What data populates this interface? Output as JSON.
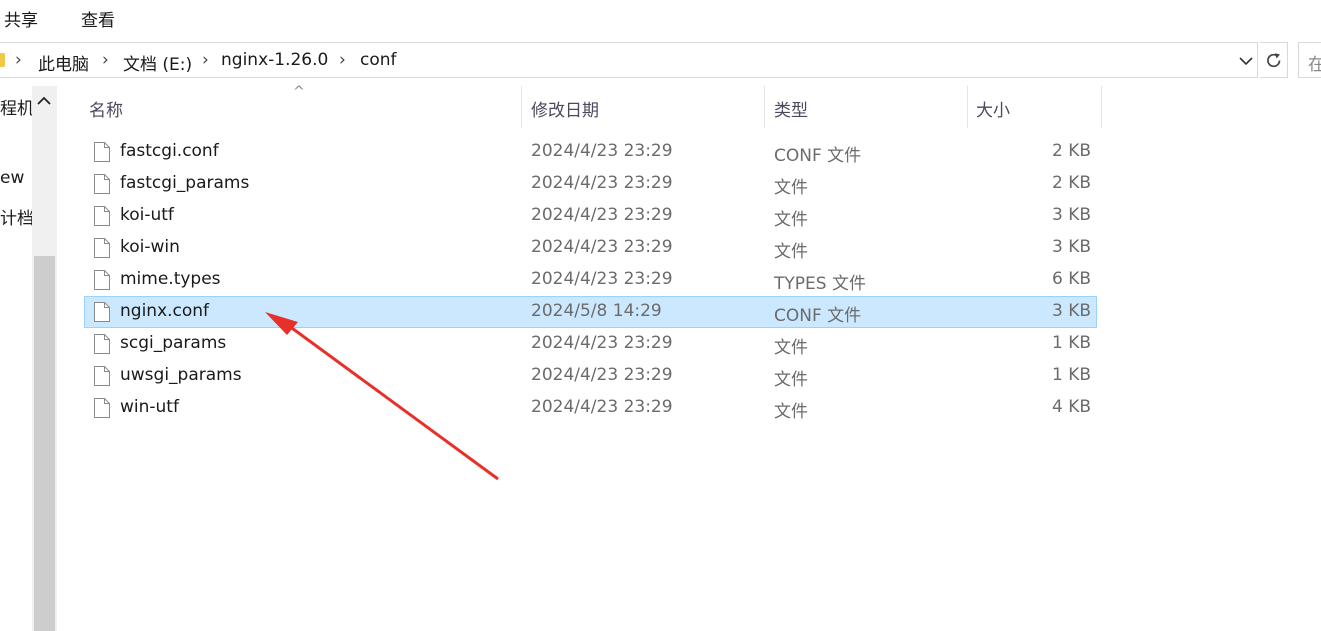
{
  "ribbon": {
    "share_label": "共享",
    "view_label": "查看"
  },
  "address": {
    "crumbs": [
      "此电脑",
      "文档 (E:)",
      "nginx-1.26.0",
      "conf"
    ],
    "search_placeholder": "在"
  },
  "nav": {
    "items": [
      "程机",
      "ew",
      "计档案"
    ]
  },
  "columns": {
    "name": "名称",
    "date": "修改日期",
    "type": "类型",
    "size": "大小"
  },
  "files": [
    {
      "name": "fastcgi.conf",
      "date": "2024/4/23 23:29",
      "type": "CONF 文件",
      "size": "2 KB"
    },
    {
      "name": "fastcgi_params",
      "date": "2024/4/23 23:29",
      "type": "文件",
      "size": "2 KB"
    },
    {
      "name": "koi-utf",
      "date": "2024/4/23 23:29",
      "type": "文件",
      "size": "3 KB"
    },
    {
      "name": "koi-win",
      "date": "2024/4/23 23:29",
      "type": "文件",
      "size": "3 KB"
    },
    {
      "name": "mime.types",
      "date": "2024/4/23 23:29",
      "type": "TYPES 文件",
      "size": "6 KB"
    },
    {
      "name": "nginx.conf",
      "date": "2024/5/8 14:29",
      "type": "CONF 文件",
      "size": "3 KB"
    },
    {
      "name": "scgi_params",
      "date": "2024/4/23 23:29",
      "type": "文件",
      "size": "1 KB"
    },
    {
      "name": "uwsgi_params",
      "date": "2024/4/23 23:29",
      "type": "文件",
      "size": "1 KB"
    },
    {
      "name": "win-utf",
      "date": "2024/4/23 23:29",
      "type": "文件",
      "size": "4 KB"
    }
  ],
  "selected_file": "nginx.conf",
  "colors": {
    "selection_bg": "#cce8ff",
    "selection_border": "#99d1ff",
    "annotation_arrow": "#e8302a",
    "folder": "#f2c744"
  },
  "icons": {
    "file": "document-icon",
    "refresh": "refresh-icon",
    "dropdown": "chevron-down-icon",
    "breadcrumb_separator": "chevron-right-icon"
  }
}
